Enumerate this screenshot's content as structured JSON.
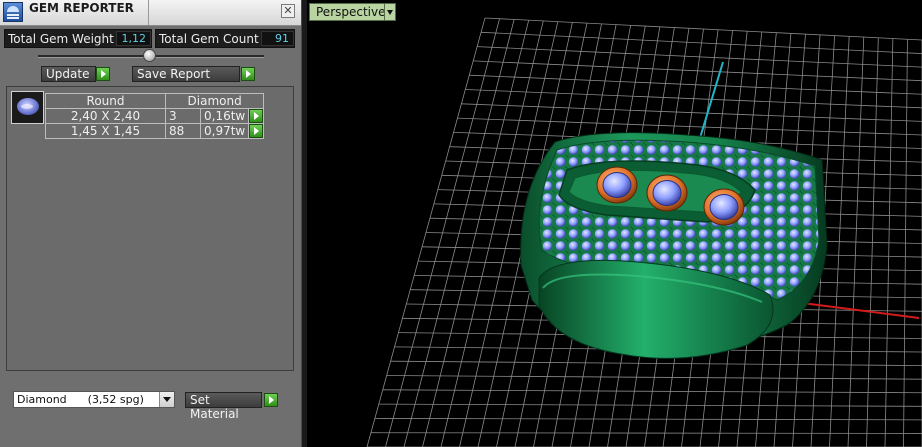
{
  "panel": {
    "title": "GEM REPORTER",
    "close_glyph": "✕",
    "total_weight_label": "Total Gem Weight",
    "total_weight_value": "1,12",
    "total_count_label": "Total Gem Count",
    "total_count_value": "91",
    "update_label": "Update",
    "save_report_label": "Save Report",
    "table": {
      "header_shape": "Round",
      "header_material": "Diamond",
      "rows": [
        {
          "size": "2,40 X 2,40",
          "count": "3",
          "weight": "0,16tw"
        },
        {
          "size": "1,45 X 1,45",
          "count": "88",
          "weight": "0,97tw"
        }
      ]
    },
    "material_select": "Diamond      (3,52 spg)",
    "set_material_label": "Set Material"
  },
  "viewport": {
    "view_label": "Perspective"
  },
  "colors": {
    "metal": "#1c8a52",
    "gem": "#8fa0ff",
    "bezel": "#e0732a",
    "value": "#5fd0e6",
    "go_button": "#3caa22",
    "axis_x": "#d21b1b",
    "axis_z": "#1fb7c8"
  },
  "icons": {
    "app": "gem-reporter-icon",
    "close": "close-icon",
    "go": "play-arrow-icon",
    "dropdown": "chevron-down-icon"
  }
}
